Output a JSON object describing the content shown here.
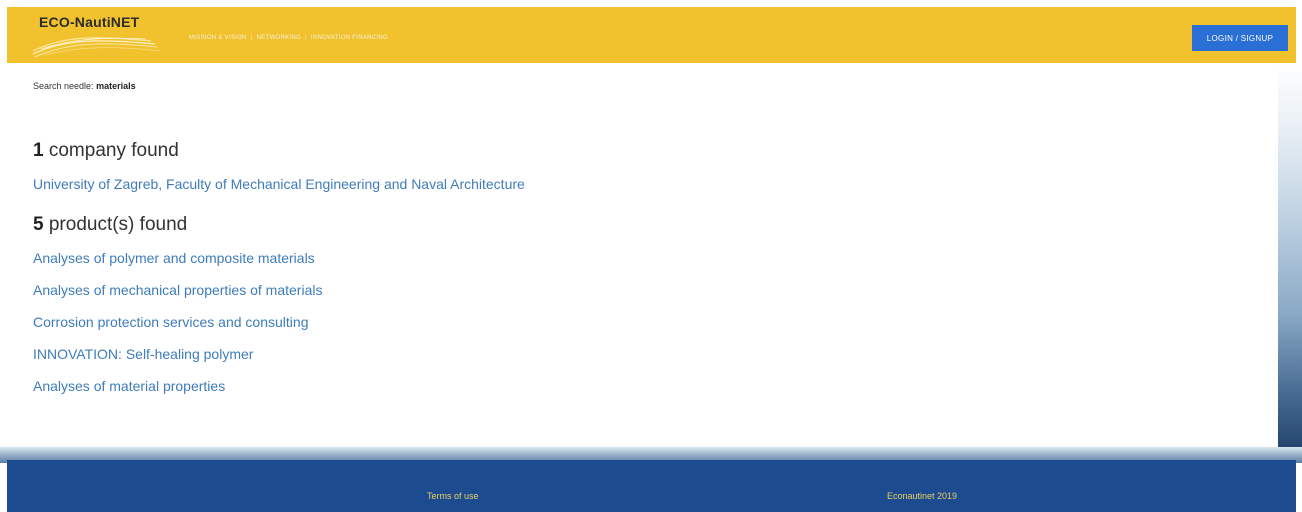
{
  "header": {
    "logo_text": "ECO-NautiNET",
    "nav": [
      "MISSION & VISION",
      "NETWORKING",
      "INNOVATION FINANCING"
    ],
    "login_label": "LOGIN / SIGNUP",
    "colors": {
      "header_bg": "#f2c12e",
      "login_bg": "#2a6fd6"
    }
  },
  "search": {
    "label": "Search needle:",
    "term": "materials"
  },
  "companies": {
    "count": "1",
    "label": "company found",
    "items": [
      "University of Zagreb, Faculty of Mechanical Engineering and Naval Architecture"
    ]
  },
  "products": {
    "count": "5",
    "label": "product(s) found",
    "items": [
      "Analyses of polymer and composite materials",
      "Analyses of mechanical properties of materials",
      "Corrosion protection services and consulting",
      "INNOVATION: Self-healing polymer",
      "Analyses of material properties"
    ]
  },
  "footer": {
    "terms_label": "Terms of use",
    "copyright": "Econautinet 2019",
    "colors": {
      "footer_bg": "#1d4b8f",
      "footer_text": "#e9cf67"
    }
  }
}
